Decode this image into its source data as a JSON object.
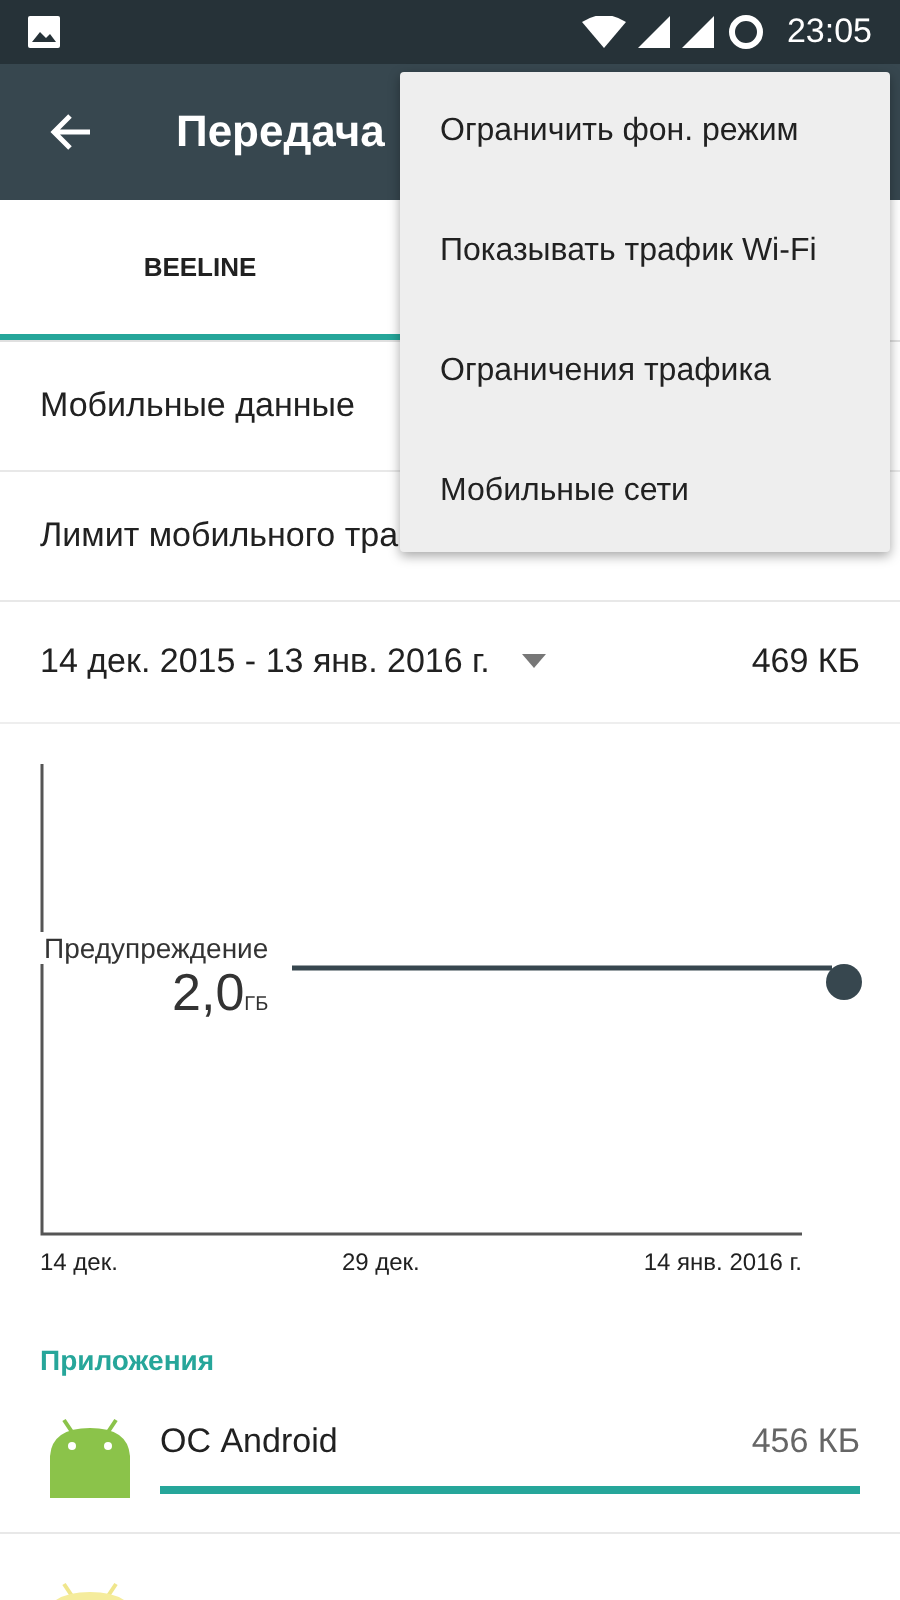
{
  "status_bar": {
    "time": "23:05"
  },
  "toolbar": {
    "title": "Передача"
  },
  "tabs": [
    {
      "label": "BEELINE",
      "selected": true
    }
  ],
  "settings": [
    {
      "label": "Мобильные данные"
    },
    {
      "label": "Лимит мобильного тра"
    }
  ],
  "cycle": {
    "range": "14 дек. 2015 - 13 янв. 2016 г.",
    "total": "469 КБ"
  },
  "chart": {
    "warning_label": "Предупреждение",
    "warning_value": "2,0",
    "warning_unit": "ГБ",
    "x_labels": [
      "14 дек.",
      "29 дек.",
      "14 янв. 2016 г."
    ]
  },
  "apps_header": "Приложения",
  "apps": [
    {
      "name": "ОС Android",
      "usage": "456 КБ",
      "level": 1.0
    }
  ],
  "menu": [
    {
      "label": "Ограничить фон. режим"
    },
    {
      "label": "Показывать трафик Wi-Fi"
    },
    {
      "label": "Ограничения трафика"
    },
    {
      "label": "Мобильные сети"
    }
  ]
}
